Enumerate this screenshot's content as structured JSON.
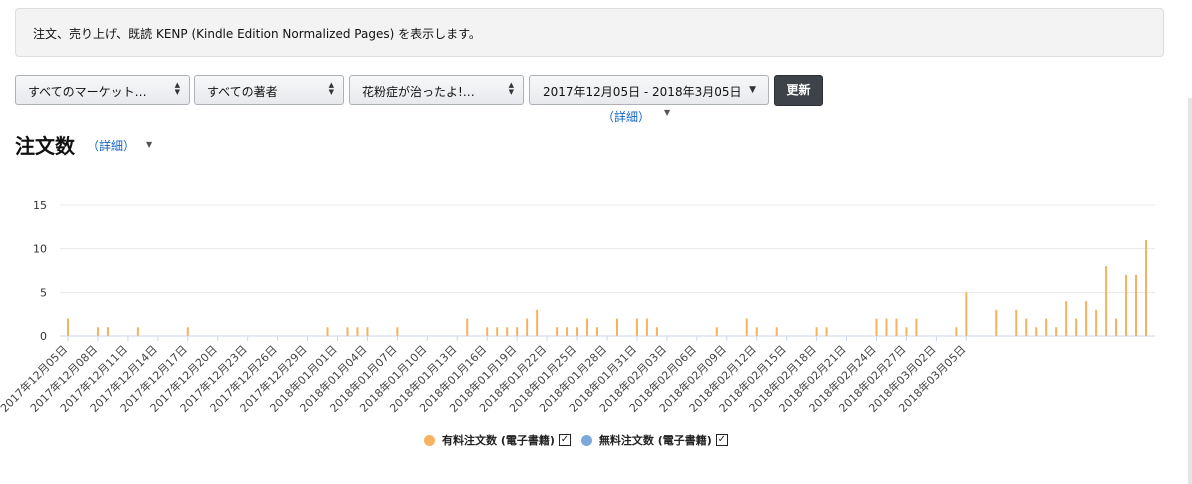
{
  "info": {
    "text": "注文、売り上げ、既読 KENP (Kindle Edition Normalized Pages) を表示します。"
  },
  "filters": {
    "marketplace": "すべてのマーケット…",
    "author": "すべての著者",
    "title": "花粉症が治ったよ!…",
    "date_range": "2017年12月05日 - 2018年3月05日",
    "date_detail": "（詳細）",
    "update_label": "更新"
  },
  "section": {
    "title": "注文数",
    "detail": "（詳細）"
  },
  "legend": {
    "paid_label": "有料注文数 (電子書籍)",
    "free_label": "無料注文数 (電子書籍)",
    "paid_checked": "✓",
    "free_checked": "✓"
  },
  "colors": {
    "paid": "#f7b25f",
    "free": "#7da8dc",
    "grid": "#e8e8e8",
    "button": "#3e4349"
  },
  "chart_data": {
    "type": "bar",
    "ylim": [
      0,
      15
    ],
    "yticks": [
      0,
      5,
      10,
      15
    ],
    "x_start": "2017-12-05",
    "tick_labels": [
      "2017年12月05日",
      "2017年12月08日",
      "2017年12月11日",
      "2017年12月14日",
      "2017年12月17日",
      "2017年12月20日",
      "2017年12月23日",
      "2017年12月26日",
      "2017年12月29日",
      "2018年01月01日",
      "2018年01月04日",
      "2018年01月07日",
      "2018年01月10日",
      "2018年01月13日",
      "2018年01月16日",
      "2018年01月19日",
      "2018年01月22日",
      "2018年01月25日",
      "2018年01月28日",
      "2018年01月31日",
      "2018年02月03日",
      "2018年02月06日",
      "2018年02月09日",
      "2018年02月12日",
      "2018年02月15日",
      "2018年02月18日",
      "2018年02月21日",
      "2018年02月24日",
      "2018年02月27日",
      "2018年03月02日",
      "2018年03月05日"
    ],
    "series": [
      {
        "name": "有料注文数 (電子書籍)",
        "values": [
          2,
          0,
          0,
          1,
          1,
          0,
          0,
          1,
          0,
          0,
          0,
          0,
          1,
          0,
          0,
          0,
          0,
          0,
          0,
          0,
          0,
          0,
          0,
          0,
          0,
          0,
          1,
          0,
          1,
          1,
          1,
          0,
          0,
          1,
          0,
          0,
          0,
          0,
          0,
          0,
          2,
          0,
          1,
          1,
          1,
          1,
          2,
          3,
          0,
          1,
          1,
          1,
          2,
          1,
          0,
          2,
          0,
          2,
          2,
          1,
          0,
          0,
          0,
          0,
          0,
          1,
          0,
          0,
          2,
          1,
          0,
          1,
          0,
          0,
          0,
          1,
          1,
          0,
          0,
          0,
          0,
          2,
          2,
          2,
          1,
          2,
          0,
          0,
          0,
          1,
          5,
          0,
          0,
          3,
          0,
          3,
          2,
          1,
          2,
          1,
          4,
          2,
          4,
          3,
          8,
          2,
          7,
          7,
          11
        ]
      },
      {
        "name": "無料注文数 (電子書籍)",
        "values": []
      }
    ]
  }
}
